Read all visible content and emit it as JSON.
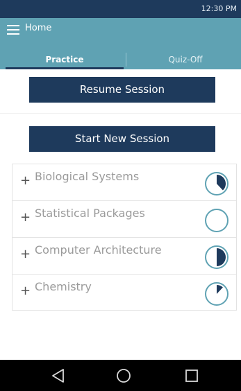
{
  "status_bar": {
    "time": "12:30 PM"
  },
  "app_bar": {
    "title": "Home",
    "menu_icon": "hamburger-menu-icon"
  },
  "tabs": [
    {
      "label": "Practice",
      "selected": true
    },
    {
      "label": "Quiz-Off",
      "selected": false
    }
  ],
  "actions": {
    "resume_label": "Resume Session",
    "new_session_label": "Start New Session"
  },
  "topics": [
    {
      "title": "Biological Systems",
      "progress": 0.38
    },
    {
      "title": "Statistical Packages",
      "progress": 0.0
    },
    {
      "title": "Computer Architecture",
      "progress": 0.5
    },
    {
      "title": "Chemistry",
      "progress": 0.12
    }
  ],
  "colors": {
    "primary_dark": "#1e3a5c",
    "app_bar": "#5fa2b3",
    "progress": "#1e3a5c",
    "progress_ring": "#5fa2b3"
  },
  "navigation": {
    "back_icon": "back-triangle-icon",
    "home_icon": "home-circle-icon",
    "recent_icon": "recent-apps-square-icon"
  }
}
